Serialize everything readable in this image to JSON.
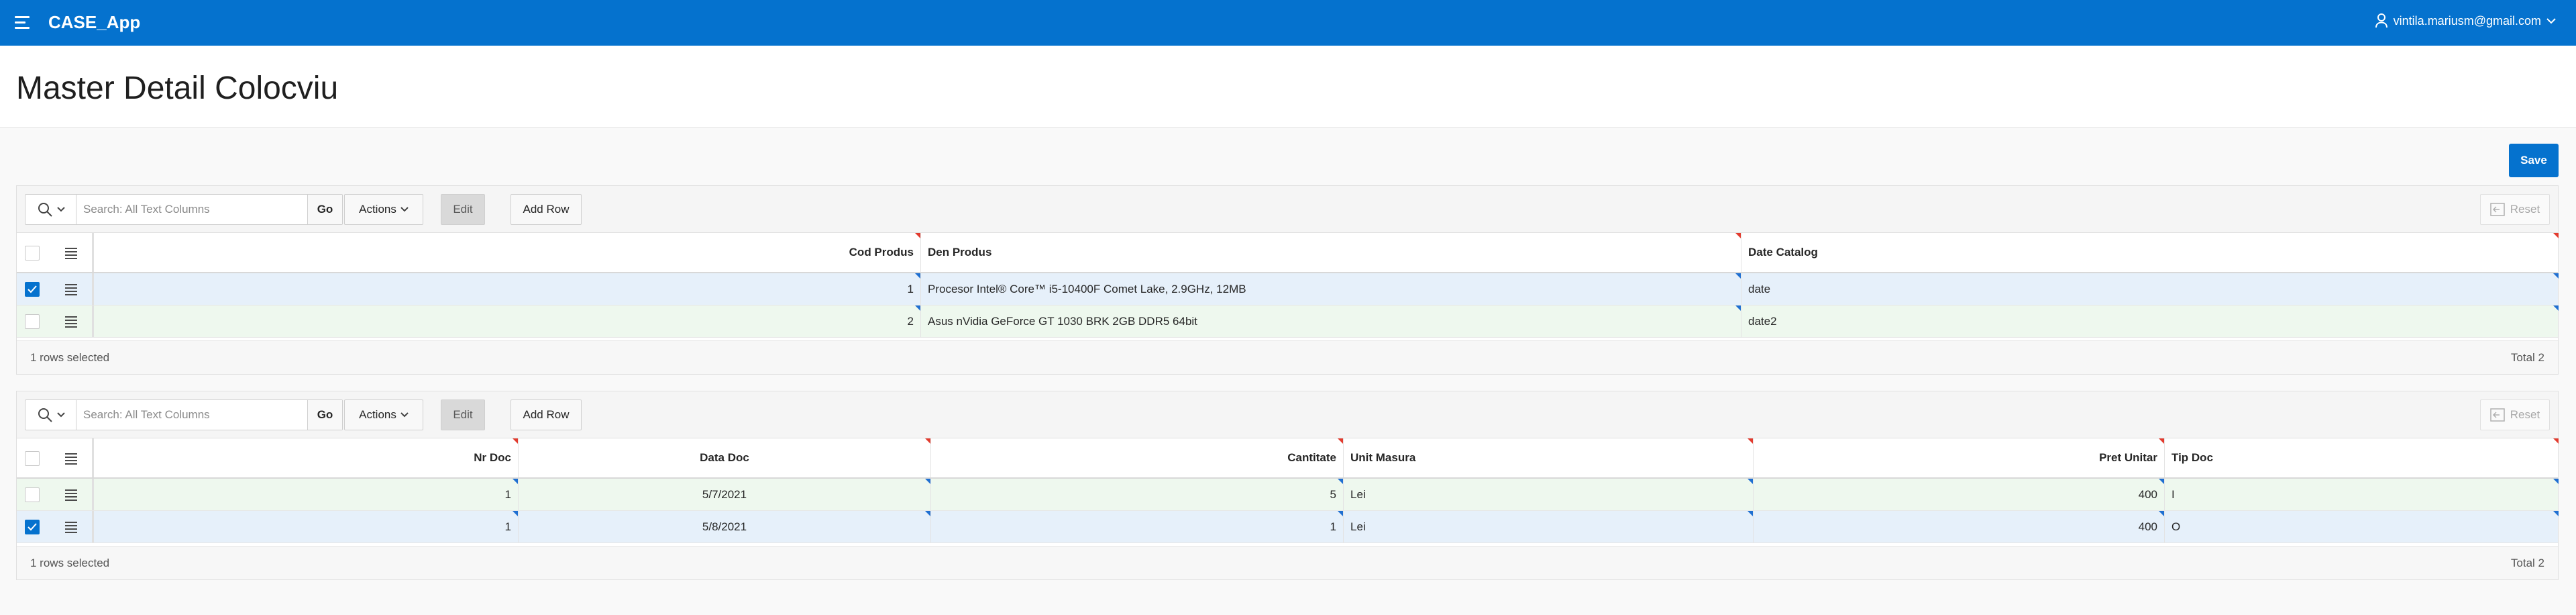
{
  "app": {
    "title": "CASE_App",
    "user_email": "vintila.mariusm@gmail.com"
  },
  "page": {
    "title": "Master Detail Colocviu",
    "save_label": "Save"
  },
  "master": {
    "toolbar": {
      "search_placeholder": "Search: All Text Columns",
      "go_label": "Go",
      "actions_label": "Actions",
      "edit_label": "Edit",
      "add_row_label": "Add Row",
      "reset_label": "Reset"
    },
    "columns": [
      "Cod Produs",
      "Den Produs",
      "Date Catalog"
    ],
    "rows": [
      {
        "selected": true,
        "cod_produs": "1",
        "den_produs": "Procesor Intel® Core™ i5-10400F Comet Lake, 2.9GHz, 12MB",
        "date_catalog": "date"
      },
      {
        "selected": false,
        "cod_produs": "2",
        "den_produs": "Asus nVidia GeForce GT 1030 BRK 2GB DDR5 64bit",
        "date_catalog": "date2"
      }
    ],
    "footer": {
      "selected_text": "1 rows selected",
      "total_text": "Total 2"
    }
  },
  "detail": {
    "toolbar": {
      "search_placeholder": "Search: All Text Columns",
      "go_label": "Go",
      "actions_label": "Actions",
      "edit_label": "Edit",
      "add_row_label": "Add Row",
      "reset_label": "Reset"
    },
    "columns": [
      "Nr Doc",
      "Data Doc",
      "Cantitate",
      "Unit Masura",
      "Pret Unitar",
      "Tip Doc"
    ],
    "rows": [
      {
        "selected": false,
        "nr_doc": "1",
        "data_doc": "5/7/2021",
        "cantitate": "5",
        "unit_masura": "Lei",
        "pret_unitar": "400",
        "tip_doc": "I"
      },
      {
        "selected": true,
        "nr_doc": "1",
        "data_doc": "5/8/2021",
        "cantitate": "1",
        "unit_masura": "Lei",
        "pret_unitar": "400",
        "tip_doc": "O"
      }
    ],
    "footer": {
      "selected_text": "1 rows selected",
      "total_text": "Total 2"
    }
  },
  "icons": {
    "menu": "hamburger-icon",
    "user": "user-icon",
    "search": "search-icon",
    "chevron": "chevron-down-icon",
    "reset": "reset-icon",
    "row_menu": "row-actions-icon",
    "check": "checkmark-icon"
  },
  "colors": {
    "accent": "#0572ce",
    "selected_row": "#e6f0fa",
    "new_row": "#eef8ee",
    "required_marker": "#e23b2e",
    "changed_marker": "#1f6fd1"
  }
}
